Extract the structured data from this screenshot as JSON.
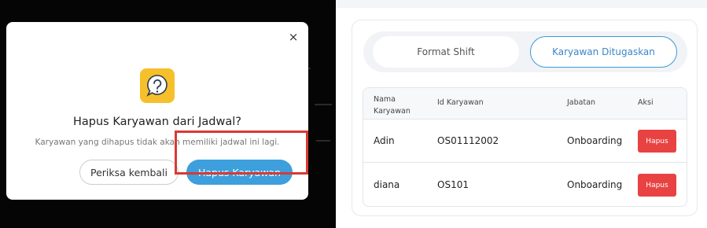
{
  "modal": {
    "title": "Hapus Karyawan dari Jadwal?",
    "description": "Karyawan yang dihapus tidak akan memiliki jadwal ini lagi.",
    "cancel_label": "Periksa kembali",
    "confirm_label": "Hapus Karyawan",
    "close_symbol": "×",
    "icon": "question-mark-icon"
  },
  "tabs": [
    {
      "label": "Format Shift",
      "active": false
    },
    {
      "label": "Karyawan Ditugaskan",
      "active": true
    }
  ],
  "table": {
    "headers": [
      "Nama\nKaryawan",
      "Id Karyawan",
      "Jabatan",
      "Aksi"
    ],
    "rows": [
      {
        "name": "Adin",
        "id": "OS01112002",
        "jabatan": "Onboarding",
        "action": "Hapus"
      },
      {
        "name": "diana",
        "id": "OS101",
        "jabatan": "Onboarding",
        "action": "Hapus"
      }
    ]
  },
  "colors": {
    "accent": "#3d9fdc",
    "danger": "#e84242",
    "icon_bg": "#f6c02c",
    "highlight": "#d93a34"
  }
}
